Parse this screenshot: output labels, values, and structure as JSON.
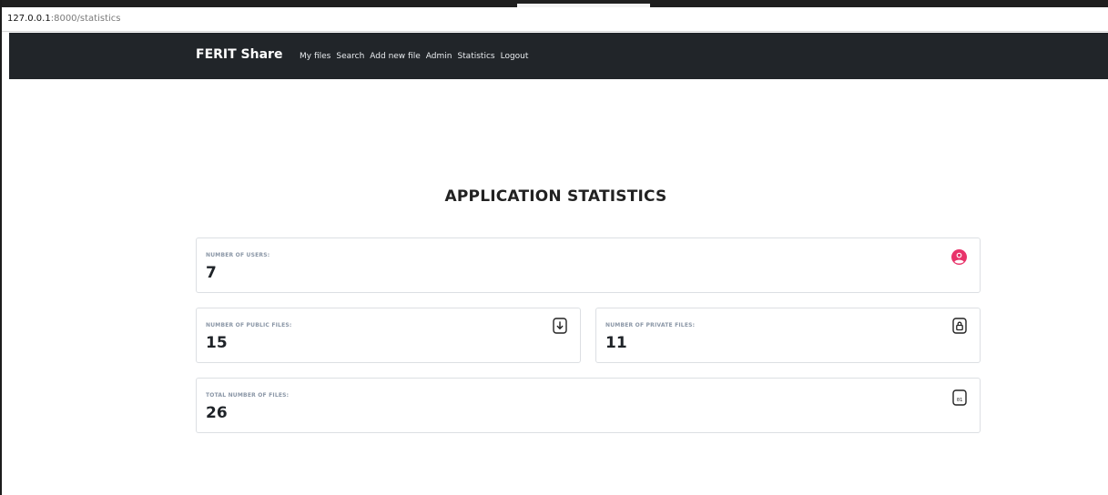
{
  "browser": {
    "url_host": "127.0.0.1",
    "url_path": ":8000/statistics"
  },
  "navbar": {
    "brand": "FERIT Share",
    "links": [
      "My files",
      "Search",
      "Add new file",
      "Admin",
      "Statistics",
      "Logout"
    ]
  },
  "page": {
    "title": "APPLICATION STATISTICS"
  },
  "stats": {
    "users": {
      "label": "NUMBER OF USERS:",
      "value": "7",
      "icon": "user-circle-icon",
      "icon_color": "#e8336a"
    },
    "public_files": {
      "label": "NUMBER OF PUBLIC FILES:",
      "value": "15",
      "icon": "file-download-icon"
    },
    "private_files": {
      "label": "NUMBER OF PRIVATE FILES:",
      "value": "11",
      "icon": "file-lock-icon"
    },
    "total_files": {
      "label": "TOTAL NUMBER OF FILES:",
      "value": "26",
      "icon": "file-binary-icon",
      "icon_text": "01"
    }
  }
}
